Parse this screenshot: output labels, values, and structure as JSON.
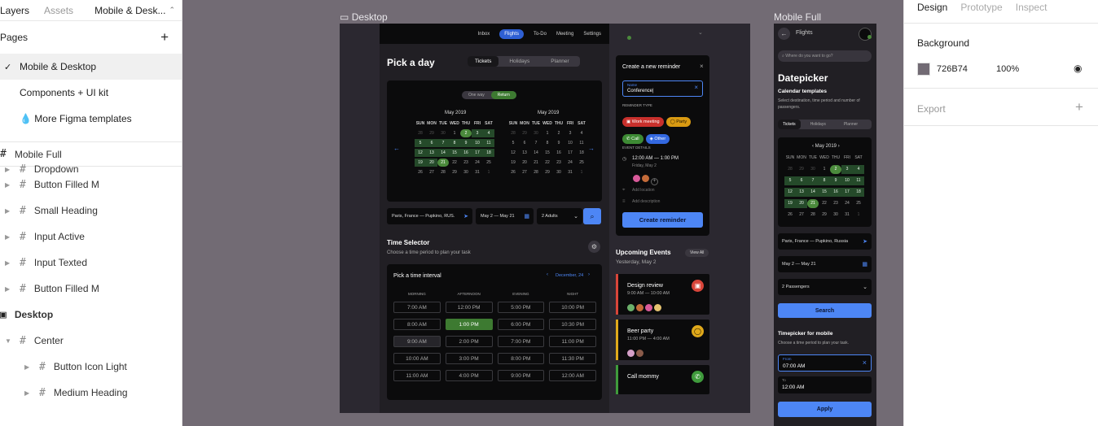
{
  "layers_panel": {
    "tabs": [
      "Layers",
      "Assets"
    ],
    "current_page_title": "Mobile & Desk...",
    "pages_heading": "Pages",
    "add_icon": "plus-icon",
    "pages": [
      "Mobile & Desktop",
      "Components + UI kit",
      "💧 More Figma templates"
    ],
    "layers": [
      {
        "name": "Mobile Full",
        "indent": 0,
        "bold": false
      },
      {
        "name": "Dropdown",
        "indent": 1
      },
      {
        "name": "Button Filled M",
        "indent": 1
      },
      {
        "name": "Small Heading",
        "indent": 1
      },
      {
        "name": "Input Active",
        "indent": 1
      },
      {
        "name": "Input Texted",
        "indent": 1
      },
      {
        "name": "Button Filled M",
        "indent": 1
      },
      {
        "name": "Desktop",
        "indent": 0
      },
      {
        "name": "Center",
        "indent": 1
      },
      {
        "name": "Button Icon Light",
        "indent": 2
      },
      {
        "name": "Medium Heading",
        "indent": 2
      }
    ]
  },
  "design_panel": {
    "tabs": [
      "Design",
      "Prototype",
      "Inspect"
    ],
    "background_label": "Background",
    "bg_hex": "726B74",
    "bg_opacity": "100%",
    "export_label": "Export",
    "swatch_color": "#726b74"
  },
  "canvas": {
    "desktop_label": "Desktop",
    "mobile_label": "Mobile Full"
  },
  "desktop": {
    "nav": [
      "Inbox",
      "Flights",
      "To-Do",
      "Meeting",
      "Settings"
    ],
    "pick_title": "Pick a day",
    "seg": [
      "Tickets",
      "Holidays",
      "Planner"
    ],
    "trip": [
      "One way",
      "Return"
    ],
    "months": [
      "May 2019",
      "May 2019"
    ],
    "weekdays": [
      "SUN",
      "MON",
      "TUE",
      "WED",
      "THU",
      "FRI",
      "SAT"
    ],
    "weeks": [
      [
        "28",
        "29",
        "30",
        "1",
        "2",
        "3",
        "4"
      ],
      [
        "5",
        "6",
        "7",
        "8",
        "9",
        "10",
        "11"
      ],
      [
        "12",
        "13",
        "14",
        "15",
        "16",
        "17",
        "18"
      ],
      [
        "19",
        "20",
        "21",
        "22",
        "23",
        "24",
        "25"
      ],
      [
        "26",
        "27",
        "28",
        "29",
        "30",
        "31",
        "1"
      ]
    ],
    "search_from": "Paris, France — Pupkino, RUS.",
    "search_dates": "May 2 — May 21",
    "search_pax": "2 Adults",
    "time_title": "Time Selector",
    "time_sub": "Choose a time period to plan your task",
    "interval_title": "Pick a time interval",
    "interval_date": "December, 24",
    "periods": [
      "MORNING",
      "AFTERNOON",
      "EVENING",
      "NIGHT"
    ],
    "slots": [
      [
        "7:00 AM",
        "12:00 PM",
        "5:00 PM",
        "10:00 PM"
      ],
      [
        "8:00 AM",
        "1:00 PM",
        "6:00 PM",
        "10:30 PM"
      ],
      [
        "9:00 AM",
        "2:00 PM",
        "7:00 PM",
        "11:00 PM"
      ],
      [
        "10:00 AM",
        "3:00 PM",
        "8:00 PM",
        "11:30 PM"
      ],
      [
        "11:00 AM",
        "4:00 PM",
        "9:00 PM",
        "12:00 AM"
      ]
    ],
    "reminder": {
      "title": "Create a new reminder",
      "name_label": "Name",
      "name_value": "Conference|",
      "type_label": "REMINDER TYPE",
      "tags": [
        "Work meeting",
        "Party",
        "Call",
        "Other"
      ],
      "details_label": "EVENT DETAILS",
      "time": "12:00 AM — 1:00 PM",
      "date": "Friday, May 2",
      "add_location": "Add location",
      "add_desc": "Add description",
      "button": "Create reminder"
    },
    "upcoming": {
      "title": "Upcoming Events",
      "view_all": "View All",
      "date": "Yesterday, May 2",
      "events": [
        {
          "title": "Design review",
          "time": "9:00 AM — 10:00 AM",
          "color": "#d8453a"
        },
        {
          "title": "Beer party",
          "time": "11:00 PM — 4:00 AM",
          "color": "#e0a91b"
        },
        {
          "title": "Call mommy",
          "time": "",
          "color": "#3f9b3c"
        }
      ]
    }
  },
  "mobile": {
    "title": "Flights",
    "search_placeholder": "Where do you want to go?",
    "heading": "Datepicker",
    "cal_title": "Calendar templates",
    "cal_sub": "Select destination, time period and number of passengers.",
    "seg": [
      "Tickets",
      "Holidays",
      "Planner"
    ],
    "month": "May 2019",
    "weekdays": [
      "SUN",
      "MON",
      "TUE",
      "WED",
      "THU",
      "FRI",
      "SAT"
    ],
    "weeks": [
      [
        "28",
        "29",
        "30",
        "1",
        "2",
        "3",
        "4"
      ],
      [
        "5",
        "6",
        "7",
        "8",
        "9",
        "10",
        "11"
      ],
      [
        "12",
        "13",
        "14",
        "15",
        "16",
        "17",
        "18"
      ],
      [
        "19",
        "20",
        "21",
        "22",
        "23",
        "24",
        "25"
      ],
      [
        "26",
        "27",
        "28",
        "29",
        "30",
        "31",
        "1"
      ]
    ],
    "route": "Paris, France — Pupkino, Russia",
    "dates": "May 2 — May 21",
    "pax": "2 Passengers",
    "search": "Search",
    "tp_title": "Timepicker for mobile",
    "tp_sub": "Choose a time period to plan your task.",
    "from_label": "From",
    "from_value": "07:00 AM",
    "to_label": "To",
    "to_value": "12:00 AM",
    "apply": "Apply"
  }
}
